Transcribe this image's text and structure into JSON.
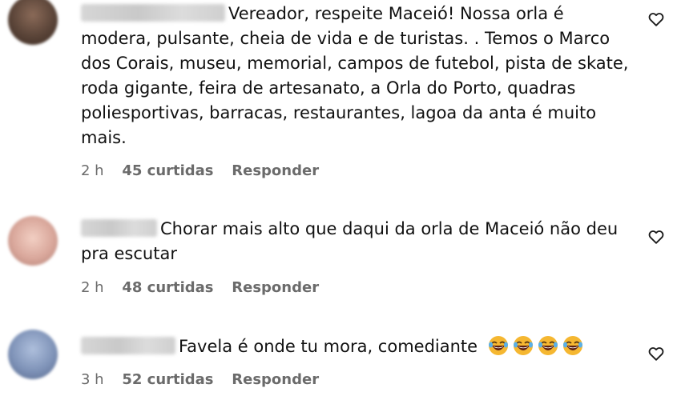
{
  "comments": [
    {
      "avatar_color": "#5a4438",
      "text": "Vereador, respeite Maceió! Nossa orla é modera, pulsante, cheia de vida e de turistas. . Temos o Marco dos Corais, museu, memorial, campos de futebol, pista de skate, roda gigante, feira de artesanato, a Orla do Porto, quadras poliesportivas, barracas, restaurantes, lagoa da anta é muito mais.",
      "time": "2 h",
      "likes": "45 curtidas",
      "reply": "Responder"
    },
    {
      "avatar_color": "#d9a79b",
      "text": "Chorar mais alto que daqui da orla de Maceió não deu pra escutar",
      "time": "2 h",
      "likes": "48 curtidas",
      "reply": "Responder"
    },
    {
      "avatar_color": "#7f93b8",
      "text": "Favela é onde tu mora, comediante",
      "emojis": [
        "rolling-on-floor-laughing",
        "rolling-on-floor-laughing",
        "rolling-on-floor-laughing",
        "rolling-on-floor-laughing"
      ],
      "time": "3 h",
      "likes": "52 curtidas",
      "reply": "Responder"
    }
  ]
}
